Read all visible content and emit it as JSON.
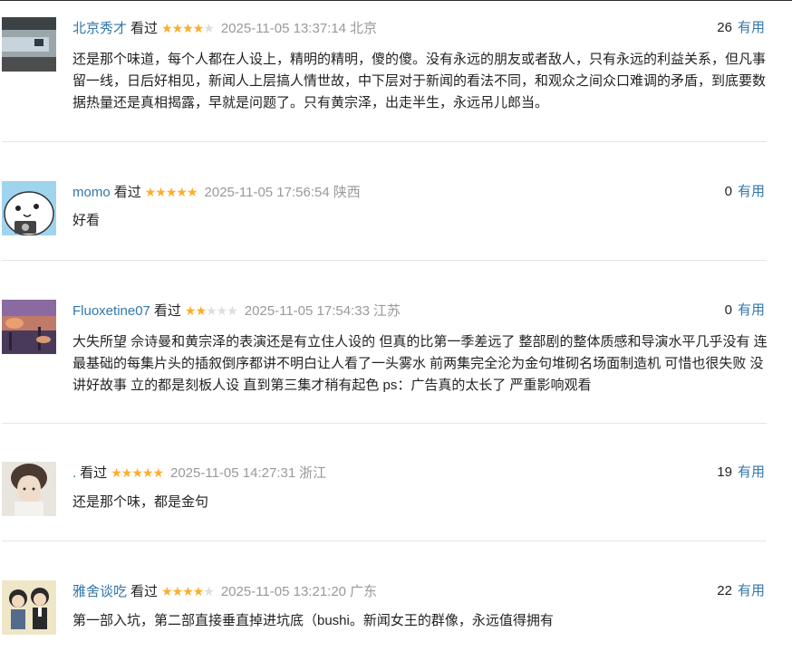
{
  "comments": [
    {
      "user": "北京秀才",
      "watched": "看过",
      "rating": 4,
      "time": "2025-11-05 13:37:14",
      "location": "北京",
      "votes": "26",
      "useful": "有用",
      "text": "还是那个味道，每个人都在人设上，精明的精明，傻的傻。没有永远的朋友或者敌人，只有永远的利益关系，但凡事留一线，日后好相见，新闻人上层搞人情世故，中下层对于新闻的看法不同，和观众之间众口难调的矛盾，到底要数据热量还是真相揭露，早就是问题了。只有黄宗泽，出走半生，永远吊儿郎当。"
    },
    {
      "user": "momo",
      "watched": "看过",
      "rating": 5,
      "time": "2025-11-05 17:56:54",
      "location": "陕西",
      "votes": "0",
      "useful": "有用",
      "text": "好看"
    },
    {
      "user": "Fluoxetine07",
      "watched": "看过",
      "rating": 2,
      "time": "2025-11-05 17:54:33",
      "location": "江苏",
      "votes": "0",
      "useful": "有用",
      "text": "大失所望 佘诗曼和黄宗泽的表演还是有立住人设的 但真的比第一季差远了 整部剧的整体质感和导演水平几乎没有 连最基础的每集片头的插叙倒序都讲不明白让人看了一头雾水 前两集完全沦为金句堆砌名场面制造机 可惜也很失败 没讲好故事 立的都是刻板人设 直到第三集才稍有起色 ps：广告真的太长了 严重影响观看"
    },
    {
      "user": ".",
      "watched": "看过",
      "rating": 5,
      "time": "2025-11-05 14:27:31",
      "location": "浙江",
      "votes": "19",
      "useful": "有用",
      "text": "还是那个味，都是金句"
    },
    {
      "user": "雅舍谈吃",
      "watched": "看过",
      "rating": 4,
      "time": "2025-11-05 13:21:20",
      "location": "广东",
      "votes": "22",
      "useful": "有用",
      "text": "第一部入坑，第二部直接垂直掉进坑底（bushi。新闻女王的群像，永远值得拥有"
    }
  ],
  "colors": {
    "link": "#3377aa",
    "star_on": "#ffac2d",
    "star_off": "#dddddd",
    "meta": "#999999"
  },
  "icons": [
    "star-icon"
  ]
}
